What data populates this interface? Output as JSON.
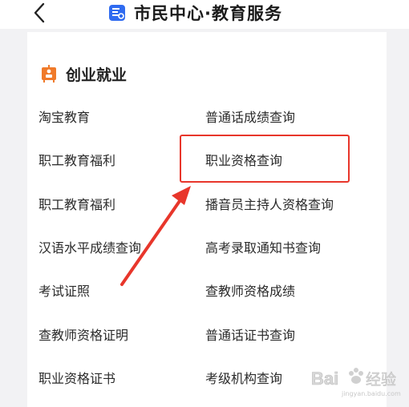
{
  "header": {
    "title": "市民中心·教育服务",
    "back_icon": "chevron-left-icon",
    "title_icon": "document-icon",
    "title_icon_color": "#2f6bf0"
  },
  "section": {
    "title": "创业就业",
    "icon": "podium-icon",
    "icon_color": "#f07a2a"
  },
  "items_left": [
    "淘宝教育",
    "职工教育福利",
    "职工教育福利",
    "汉语水平成绩查询",
    "考试证照",
    "查教师资格证明",
    "职业资格证书"
  ],
  "items_right": [
    "普通话成绩查询",
    "职业资格查询",
    "播音员主持人资格查询",
    "高考录取通知书查询",
    "查教师资格成绩",
    "普通话证书查询",
    "考级机构查询"
  ],
  "annotation": {
    "highlight_color": "#e8362b",
    "highlighted_item": "职业资格查询"
  },
  "watermark": {
    "text": "Bai 经验",
    "sub": "jingyan.baidu.com"
  }
}
